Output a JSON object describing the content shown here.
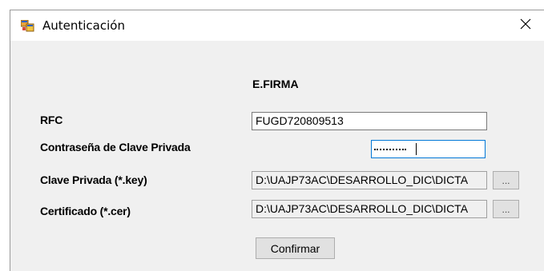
{
  "window": {
    "title": "Autenticación"
  },
  "form": {
    "heading": "E.FIRMA",
    "rfc_label": "RFC",
    "rfc_value": "FUGD720809513",
    "password_label": "Contraseña de Clave Privada",
    "key_label": "Clave Privada (*.key)",
    "key_value": "D:\\UAJP73AC\\DESARROLLO_DIC\\DICTA",
    "cert_label": "Certificado (*.cer)",
    "cert_value": "D:\\UAJP73AC\\DESARROLLO_DIC\\DICTA",
    "browse_label": "...",
    "confirm_label": "Confirmar"
  },
  "icons": {
    "app": "app-window-icon",
    "close": "close-icon"
  },
  "colors": {
    "focus_border": "#0078d7",
    "window_bg": "#f0f0f0"
  }
}
